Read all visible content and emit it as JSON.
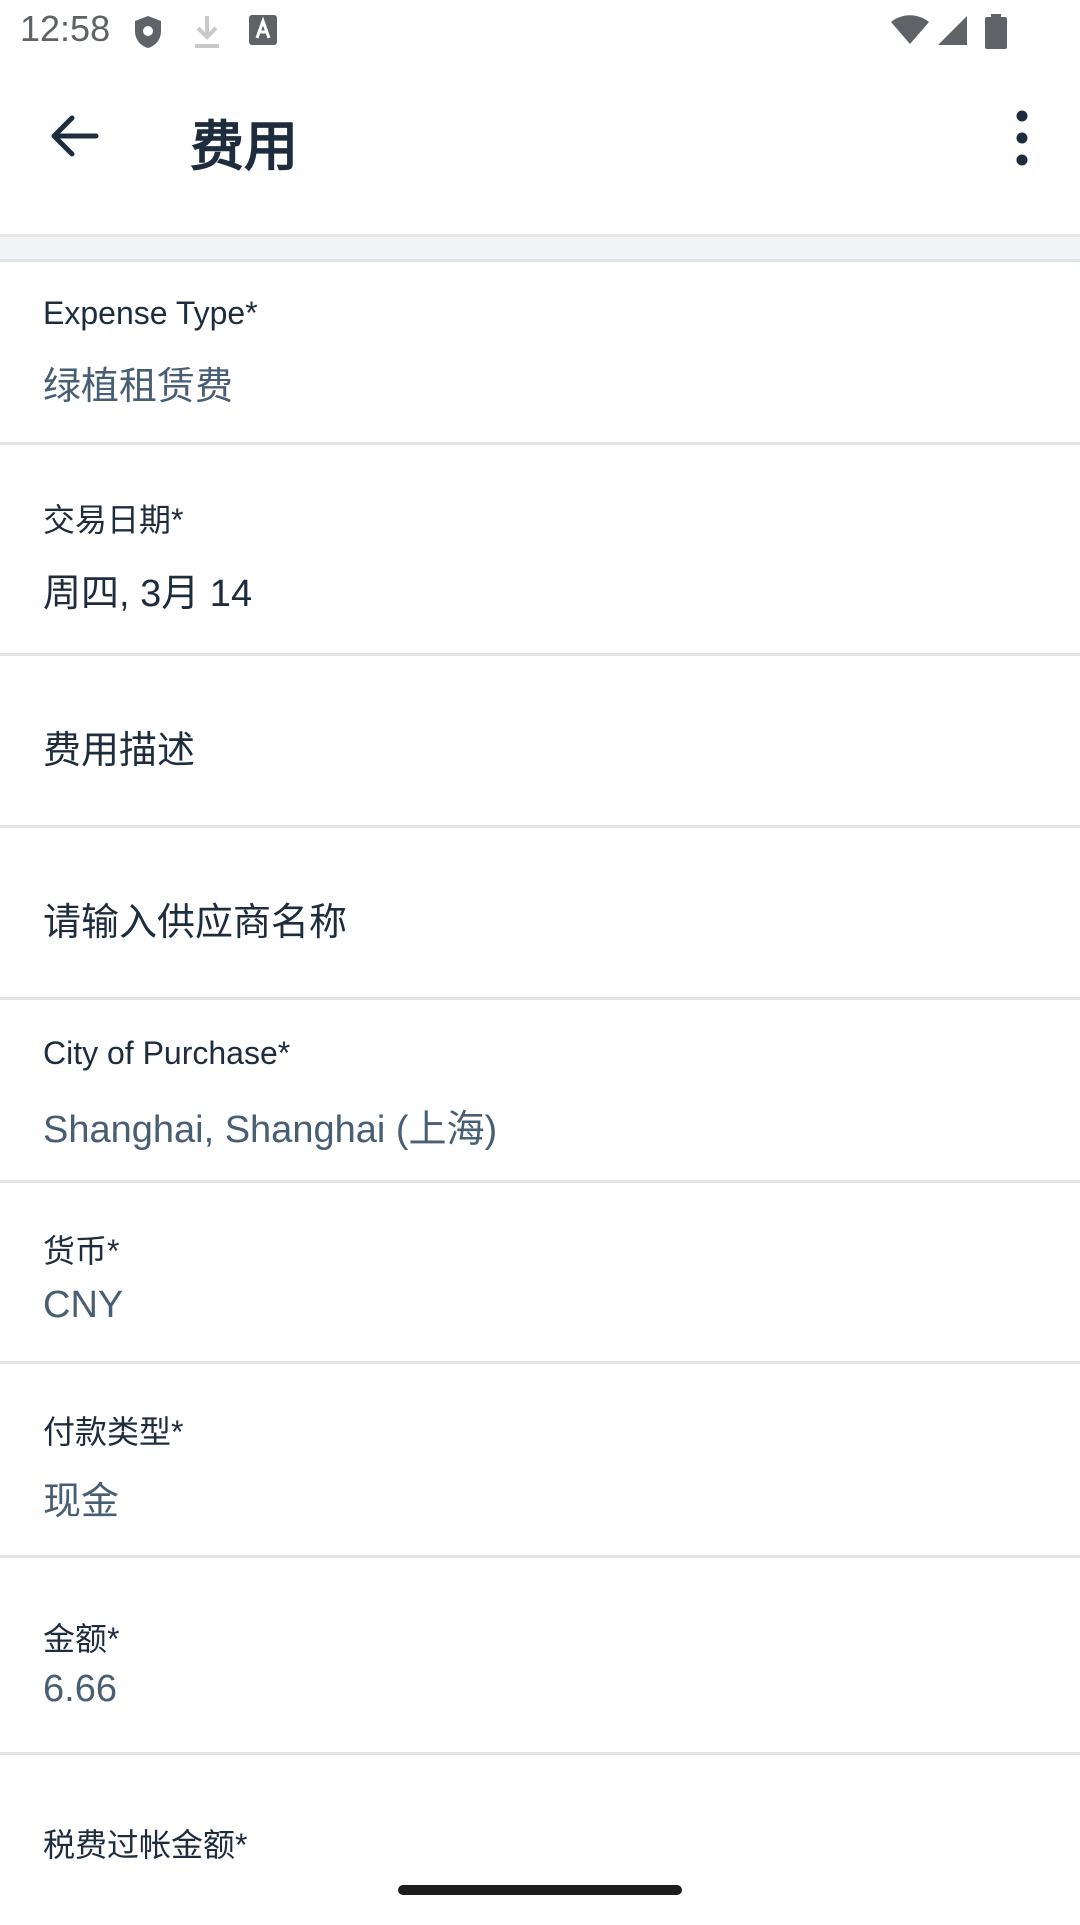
{
  "status_bar": {
    "time": "12:58",
    "icons_left": [
      "shield-icon",
      "download-icon",
      "keyboard-a-icon"
    ],
    "icons_right": [
      "wifi-icon",
      "signal-icon",
      "battery-icon"
    ]
  },
  "app_bar": {
    "title": "费用",
    "back_icon": "arrow-left-icon",
    "menu_icon": "more-vertical-icon"
  },
  "form": {
    "expense_type": {
      "label": "Expense Type*",
      "value": "绿植租赁费"
    },
    "transaction_date": {
      "label": "交易日期*",
      "value": "周四, 3月 14"
    },
    "description": {
      "placeholder": "费用描述"
    },
    "vendor": {
      "placeholder": "请输入供应商名称"
    },
    "city": {
      "label": "City of Purchase*",
      "value": "Shanghai, Shanghai (上海)"
    },
    "currency": {
      "label": "货币*",
      "value": "CNY"
    },
    "payment_type": {
      "label": "付款类型*",
      "value": "现金"
    },
    "amount": {
      "label": "金额*",
      "value": "6.66"
    },
    "tax_amount": {
      "label": "税费过帐金额*"
    }
  },
  "colors": {
    "text_primary": "#1d2d3e",
    "text_value": "#475e75",
    "divider": "#e2e4e6"
  }
}
